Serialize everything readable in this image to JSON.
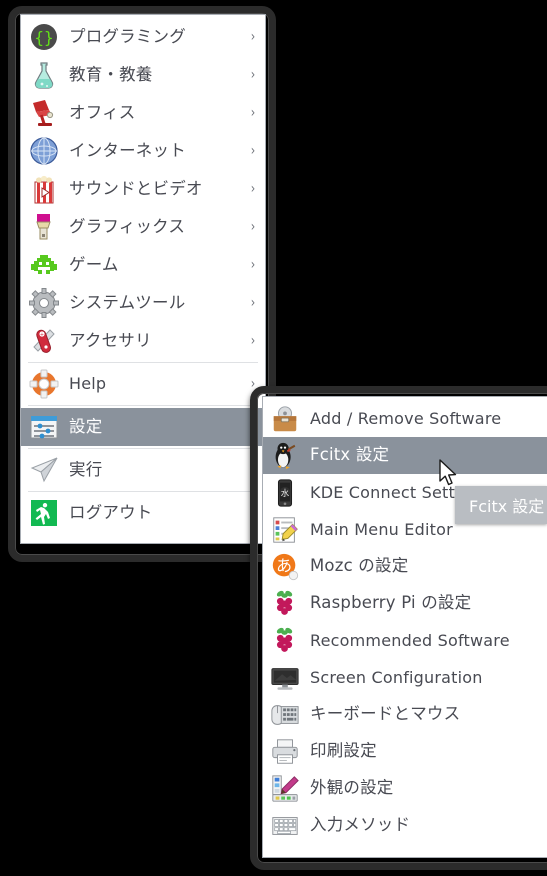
{
  "main_menu": {
    "items": [
      {
        "label": "プログラミング",
        "icon": "programming-icon",
        "submenu": true
      },
      {
        "label": "教育・教養",
        "icon": "education-icon",
        "submenu": true
      },
      {
        "label": "オフィス",
        "icon": "office-icon",
        "submenu": true
      },
      {
        "label": "インターネット",
        "icon": "internet-icon",
        "submenu": true
      },
      {
        "label": "サウンドとビデオ",
        "icon": "sound-video-icon",
        "submenu": true
      },
      {
        "label": "グラフィックス",
        "icon": "graphics-icon",
        "submenu": true
      },
      {
        "label": "ゲーム",
        "icon": "games-icon",
        "submenu": true
      },
      {
        "label": "システムツール",
        "icon": "system-tools-icon",
        "submenu": true
      },
      {
        "label": "アクセサリ",
        "icon": "accessories-icon",
        "submenu": true
      },
      {
        "label": "Help",
        "icon": "help-icon",
        "submenu": true
      },
      {
        "label": "設定",
        "icon": "preferences-icon",
        "submenu": true,
        "selected": true
      },
      {
        "label": "実行",
        "icon": "run-icon",
        "submenu": false
      },
      {
        "label": "ログアウト",
        "icon": "logout-icon",
        "submenu": false
      }
    ],
    "chevron": "›"
  },
  "submenu": {
    "items": [
      {
        "label": "Add / Remove Software",
        "icon": "add-remove-software-icon"
      },
      {
        "label": "Fcitx 設定",
        "icon": "fcitx-penguin-icon",
        "selected": true
      },
      {
        "label": "KDE Connect Settings",
        "icon": "kde-connect-icon"
      },
      {
        "label": "Main Menu Editor",
        "icon": "main-menu-editor-icon"
      },
      {
        "label": "Mozc の設定",
        "icon": "mozc-icon"
      },
      {
        "label": "Raspberry Pi の設定",
        "icon": "raspberry-pi-icon"
      },
      {
        "label": "Recommended Software",
        "icon": "raspberry-pi-icon"
      },
      {
        "label": "Screen Configuration",
        "icon": "screen-configuration-icon"
      },
      {
        "label": "キーボードとマウス",
        "icon": "keyboard-mouse-icon"
      },
      {
        "label": "印刷設定",
        "icon": "printer-icon"
      },
      {
        "label": "外観の設定",
        "icon": "appearance-icon"
      },
      {
        "label": "入力メソッド",
        "icon": "input-method-icon"
      }
    ]
  },
  "tooltip": {
    "text": "Fcitx 設定"
  },
  "colors": {
    "selection": "#8a929c",
    "label": "#484a52",
    "panel_bg": "#ffffff",
    "separator": "#dfe1e4",
    "tooltip_bg": "#b9bdc2",
    "frame": "#2b2b2b"
  }
}
